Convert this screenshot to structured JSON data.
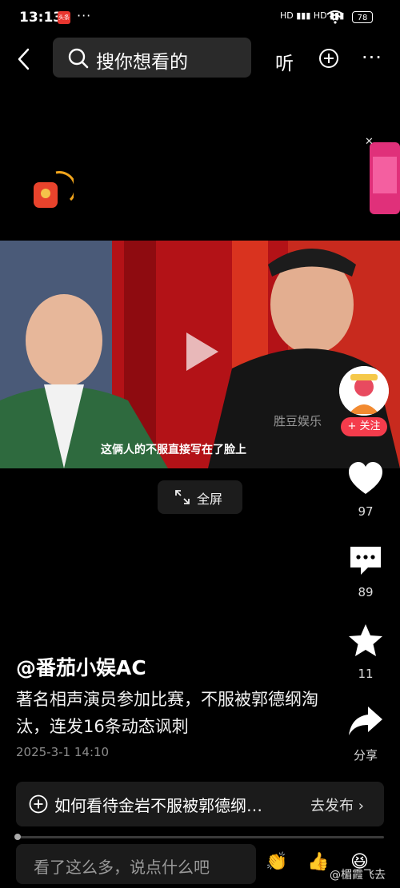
{
  "status_bar": {
    "time": "13:13",
    "app_badge": "头条",
    "dots": "···",
    "signal": "HD ▮▮▮ HD ▮▮▮",
    "battery": "78"
  },
  "nav": {
    "search_placeholder": "搜你想看的",
    "listen_label": "听",
    "more_label": "···"
  },
  "video": {
    "caption": "这俩人的不服直接写在了脸上",
    "watermark": "胜豆娱乐",
    "fullscreen_label": "全屏"
  },
  "side": {
    "follow_label": "+ 关注",
    "like_count": "97",
    "comment_count": "89",
    "favorite_count": "11",
    "share_label": "分享"
  },
  "post": {
    "author": "@番茄小娱AC",
    "description": "著名相声演员参加比赛，不服被郭德纲淘汰，连发16条动态讽刺",
    "date": "2025-3-1 14:10"
  },
  "topic": {
    "text": "如何看待金岩不服被郭德纲…",
    "publish_label": "去发布 ›"
  },
  "progress": {
    "fraction": 0.01
  },
  "comment": {
    "placeholder": "看了这么多，说点什么吧",
    "emoji_1": "👏",
    "emoji_2": "👍",
    "emoji_3": "😆"
  },
  "uploader_watermark": "@楣霞飞去",
  "colors": {
    "follow_red": "#f43c4c",
    "background": "#000000"
  }
}
